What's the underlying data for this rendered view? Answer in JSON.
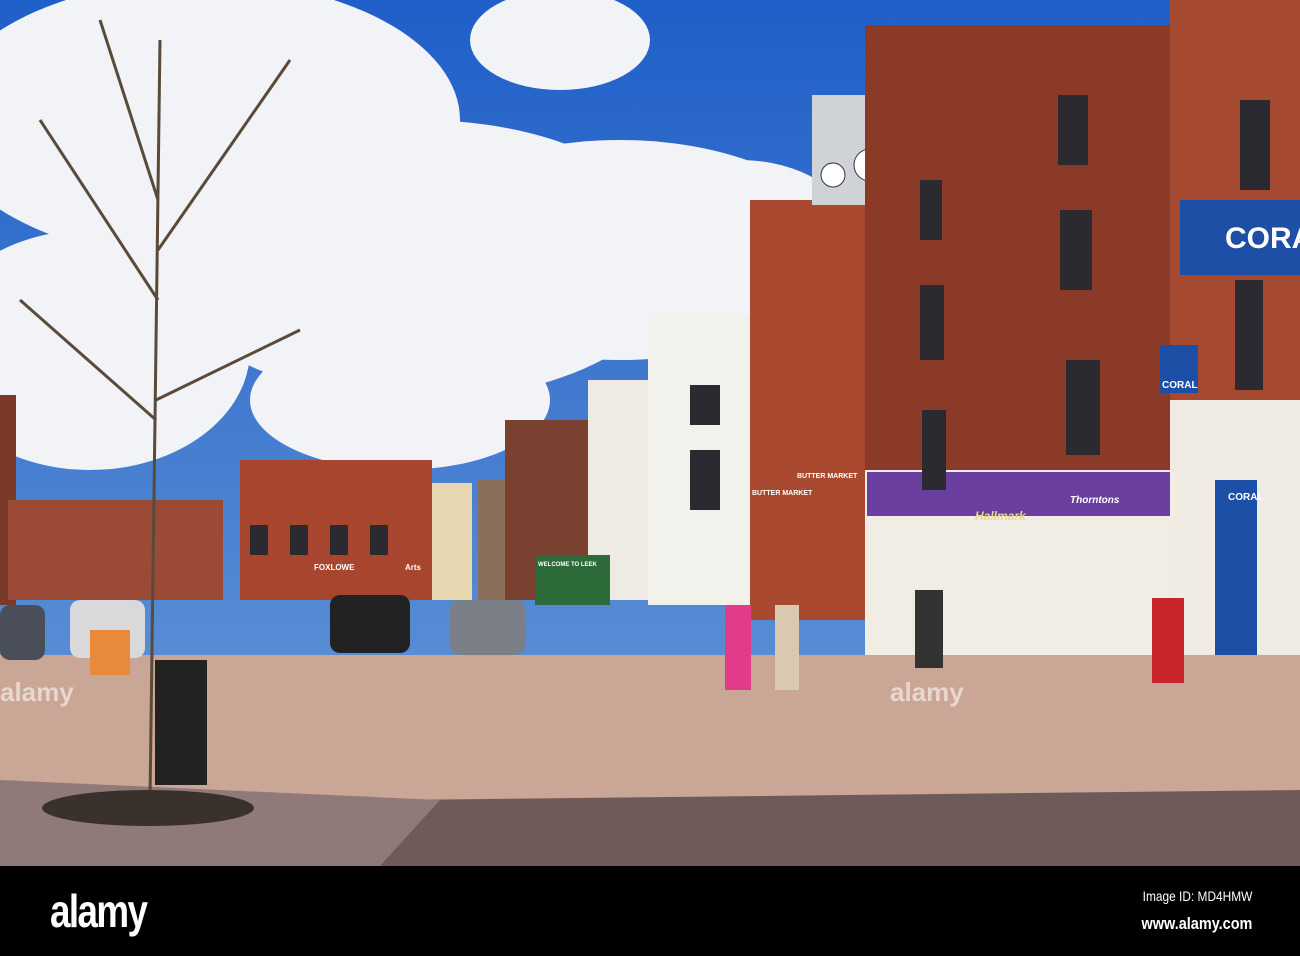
{
  "photo": {
    "signs": {
      "coral_top": "CORAL",
      "coral_hanging": "CORAL",
      "coral_door": "CORAL",
      "butter_market_1": "BUTTER MARKET",
      "butter_market_2": "BUTTER MARKET",
      "welcome": "WELCOME TO LEEK",
      "foxlowe": "FOXLOWE",
      "arts": "Arts",
      "hallmark": "Hallmark",
      "thorntons": "Thorntons"
    },
    "colors": {
      "sky": "#2f6fd0",
      "brick": "#8a3a26",
      "paving": "#c9a695",
      "purple": "#6a3fa0",
      "coral_blue": "#1d4fa6"
    }
  },
  "watermark": {
    "logo": "alamy",
    "image_id": "Image ID: MD4HMW",
    "url": "www.alamy.com",
    "overlay": "alamy"
  }
}
